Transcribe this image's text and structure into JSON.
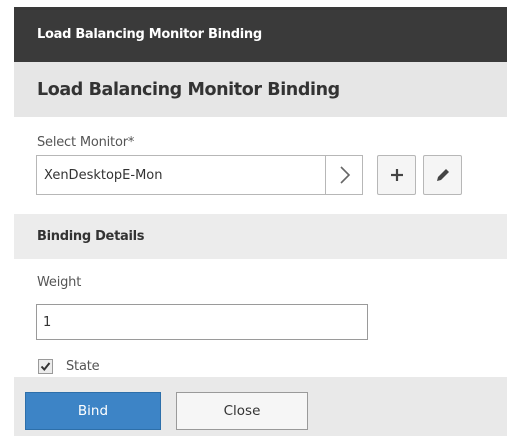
{
  "window": {
    "title": "Load Balancing Monitor Binding"
  },
  "panel": {
    "heading": "Load Balancing Monitor Binding"
  },
  "select_monitor": {
    "label": "Select Monitor*",
    "value": "XenDesktopE-Mon",
    "navigate_icon": "chevron-right-icon",
    "add_icon": "plus-icon",
    "edit_icon": "pencil-icon"
  },
  "binding_details": {
    "heading": "Binding Details",
    "weight_label": "Weight",
    "weight_value": "1",
    "state_label": "State",
    "state_checked": true
  },
  "footer": {
    "bind_label": "Bind",
    "close_label": "Close"
  },
  "colors": {
    "titlebar_bg": "#3a3a3a",
    "primary_button": "#3d84c6"
  }
}
